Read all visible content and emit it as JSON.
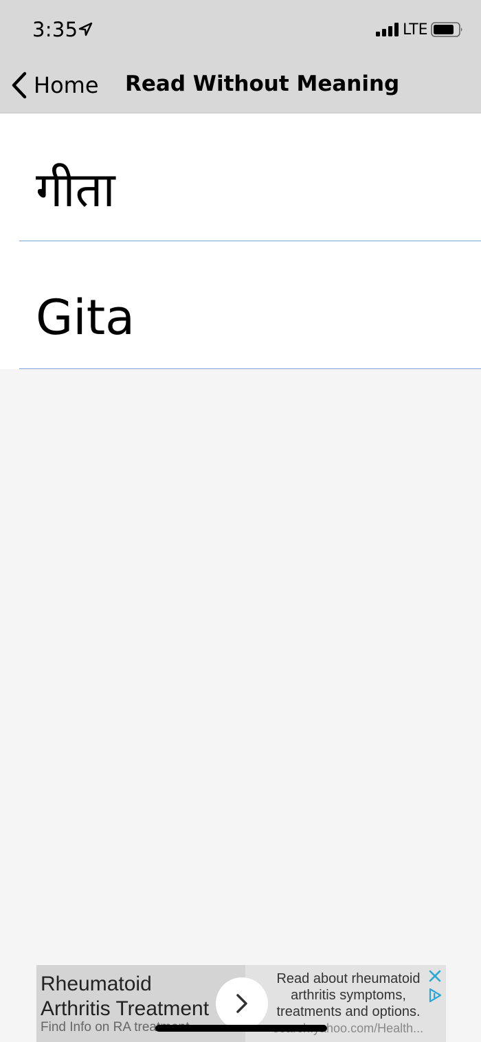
{
  "status_bar": {
    "time": "3:35",
    "network": "LTE",
    "icons": [
      "location-arrow-icon",
      "signal-bars-icon",
      "battery-icon"
    ]
  },
  "nav_bar": {
    "back_label": "Home",
    "title": "Read Without Meaning",
    "back_icon": "chevron-left-icon"
  },
  "list": {
    "items": [
      {
        "label": "गीता"
      },
      {
        "label": "Gita"
      }
    ]
  },
  "ad": {
    "title": "Rheumatoid Arthritis Treatment",
    "subtitle": "Find Info on RA treatment",
    "description": "Read about rheumatoid arthritis symptoms, treatments and options.",
    "url": "search.yahoo.com/Health...",
    "icons": [
      "chevron-right-icon",
      "close-icon",
      "ad-choices-icon"
    ]
  },
  "colors": {
    "header_background": "#d8d8d8",
    "content_background": "#f5f5f5",
    "row_divider": "#7e9fd8",
    "ad_accent": "#2aa7d6"
  }
}
